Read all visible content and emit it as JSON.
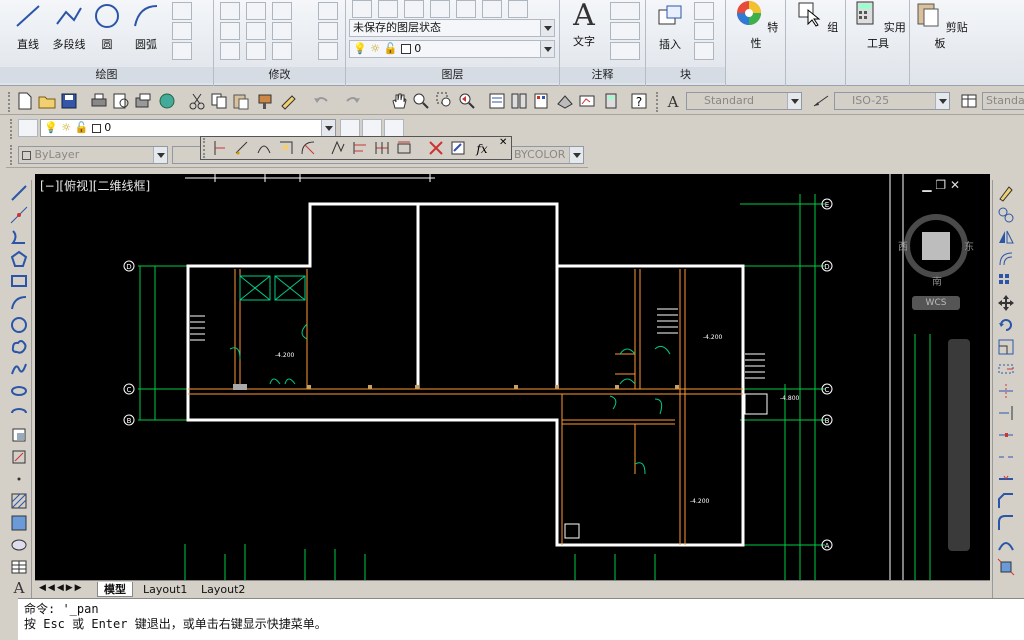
{
  "ribbon": {
    "draw": {
      "title": "绘图",
      "line": "直线",
      "polyline": "多段线",
      "circle": "圆",
      "arc": "圆弧"
    },
    "modify": {
      "title": "修改"
    },
    "layers": {
      "title": "图层",
      "state": "未保存的图层状态",
      "current_layer": "0"
    },
    "annotation": {
      "title": "注释",
      "text": "文字"
    },
    "block": {
      "title": "块",
      "insert": "插入"
    },
    "properties": {
      "label": "特性"
    },
    "group": {
      "label": "组"
    },
    "utilities": {
      "label": "实用工具"
    },
    "clipboard": {
      "label": "剪贴板"
    }
  },
  "toolbar": {
    "text_style": "Standard",
    "dim_style": "ISO-25",
    "table_style": "Standa",
    "layer_combo": "0",
    "color": "ByLayer",
    "plot_style": "BYCOLOR"
  },
  "viewport": {
    "label": "[−][俯视][二维线框]"
  },
  "viewcube": {
    "west": "西",
    "east": "东",
    "south": "南",
    "wcs": "WCS"
  },
  "grid_labels": {
    "E": "E",
    "D": "D",
    "C": "C",
    "B": "B",
    "A": "A"
  },
  "drawing_text": {
    "elev1": "-4.200",
    "elev2": "-4.200",
    "elev3": "-4.200",
    "elev4": "-4.200",
    "elev5": "-4.800"
  },
  "tabs": [
    {
      "label": "模型"
    },
    {
      "label": "Layout1"
    },
    {
      "label": "Layout2"
    }
  ],
  "command": {
    "line1": "命令:  '_pan",
    "line2": "按 Esc 或 Enter 键退出，或单击右键显示快捷菜单。"
  },
  "colors": {
    "wall": "#ffffff",
    "dim": "#00cc44",
    "room": "#ff9933",
    "door": "#00cc88",
    "background": "#000000"
  }
}
